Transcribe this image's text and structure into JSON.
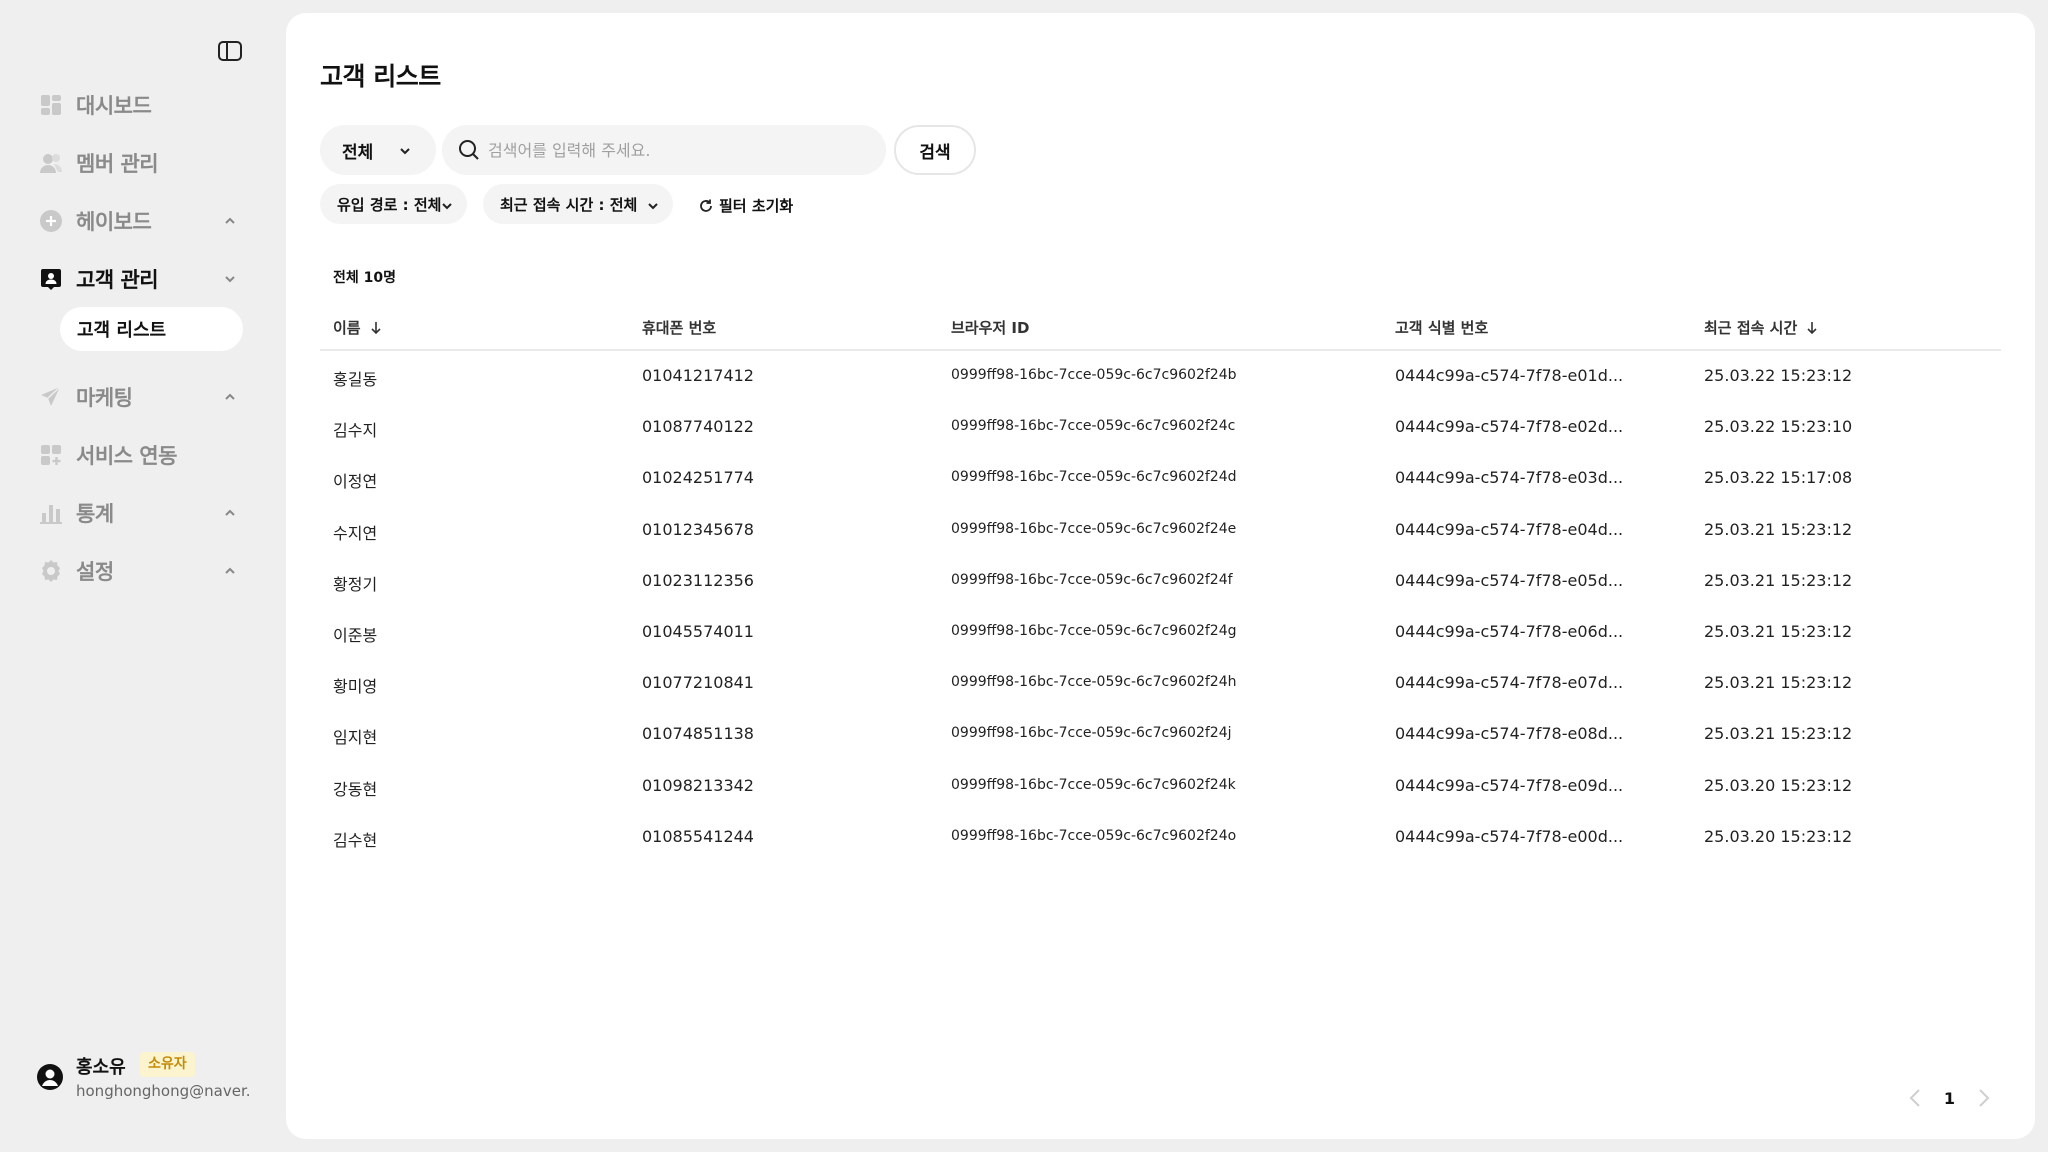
{
  "sidebar": {
    "items": [
      {
        "label": "대시보드"
      },
      {
        "label": "멤버 관리"
      },
      {
        "label": "헤이보드"
      },
      {
        "label": "고객 관리"
      },
      {
        "label": "마케팅"
      },
      {
        "label": "서비스 연동"
      },
      {
        "label": "통계"
      },
      {
        "label": "설정"
      }
    ],
    "sub_item": "고객 리스트"
  },
  "user": {
    "name": "홍소유",
    "role": "소유자",
    "email": "honghonghong@naver...."
  },
  "page": {
    "title": "고객 리스트",
    "scope": "전체",
    "search_placeholder": "검색어를 입력해 주세요.",
    "search_button": "검색",
    "filter_source": "유입 경로 : 전체",
    "filter_time": "최근 접속 시간 : 전체",
    "filter_reset": "필터 초기화",
    "total": "전체 10명"
  },
  "table": {
    "headers": [
      "이름",
      "휴대폰 번호",
      "브라우저 ID",
      "고객 식별 번호",
      "최근 접속 시간"
    ],
    "rows": [
      [
        "홍길동",
        "01041217412",
        "0999ff98-16bc-7cce-059c-6c7c9602f24b",
        "0444c99a-c574-7f78-e01d...",
        "25.03.22 15:23:12"
      ],
      [
        "김수지",
        "01087740122",
        "0999ff98-16bc-7cce-059c-6c7c9602f24c",
        "0444c99a-c574-7f78-e02d...",
        "25.03.22 15:23:10"
      ],
      [
        "이정연",
        "01024251774",
        "0999ff98-16bc-7cce-059c-6c7c9602f24d",
        "0444c99a-c574-7f78-e03d...",
        "25.03.22 15:17:08"
      ],
      [
        "수지연",
        "01012345678",
        "0999ff98-16bc-7cce-059c-6c7c9602f24e",
        "0444c99a-c574-7f78-e04d...",
        "25.03.21 15:23:12"
      ],
      [
        "황정기",
        "01023112356",
        "0999ff98-16bc-7cce-059c-6c7c9602f24f",
        "0444c99a-c574-7f78-e05d...",
        "25.03.21 15:23:12"
      ],
      [
        "이준봉",
        "01045574011",
        "0999ff98-16bc-7cce-059c-6c7c9602f24g",
        "0444c99a-c574-7f78-e06d...",
        "25.03.21 15:23:12"
      ],
      [
        "황미영",
        "01077210841",
        "0999ff98-16bc-7cce-059c-6c7c9602f24h",
        "0444c99a-c574-7f78-e07d...",
        "25.03.21 15:23:12"
      ],
      [
        "임지현",
        "01074851138",
        "0999ff98-16bc-7cce-059c-6c7c9602f24j",
        "0444c99a-c574-7f78-e08d...",
        "25.03.21 15:23:12"
      ],
      [
        "강동현",
        "01098213342",
        "0999ff98-16bc-7cce-059c-6c7c9602f24k",
        "0444c99a-c574-7f78-e09d...",
        "25.03.20 15:23:12"
      ],
      [
        "김수현",
        "01085541244",
        "0999ff98-16bc-7cce-059c-6c7c9602f24o",
        "0444c99a-c574-7f78-e00d...",
        "25.03.20 15:23:12"
      ]
    ]
  },
  "pagination": {
    "current": "1"
  },
  "colors": {
    "background": "#efefef",
    "panel": "#ffffff",
    "badge_bg": "#fcf4cf",
    "badge_text": "#c48b07",
    "muted": "#8a8a8a"
  }
}
